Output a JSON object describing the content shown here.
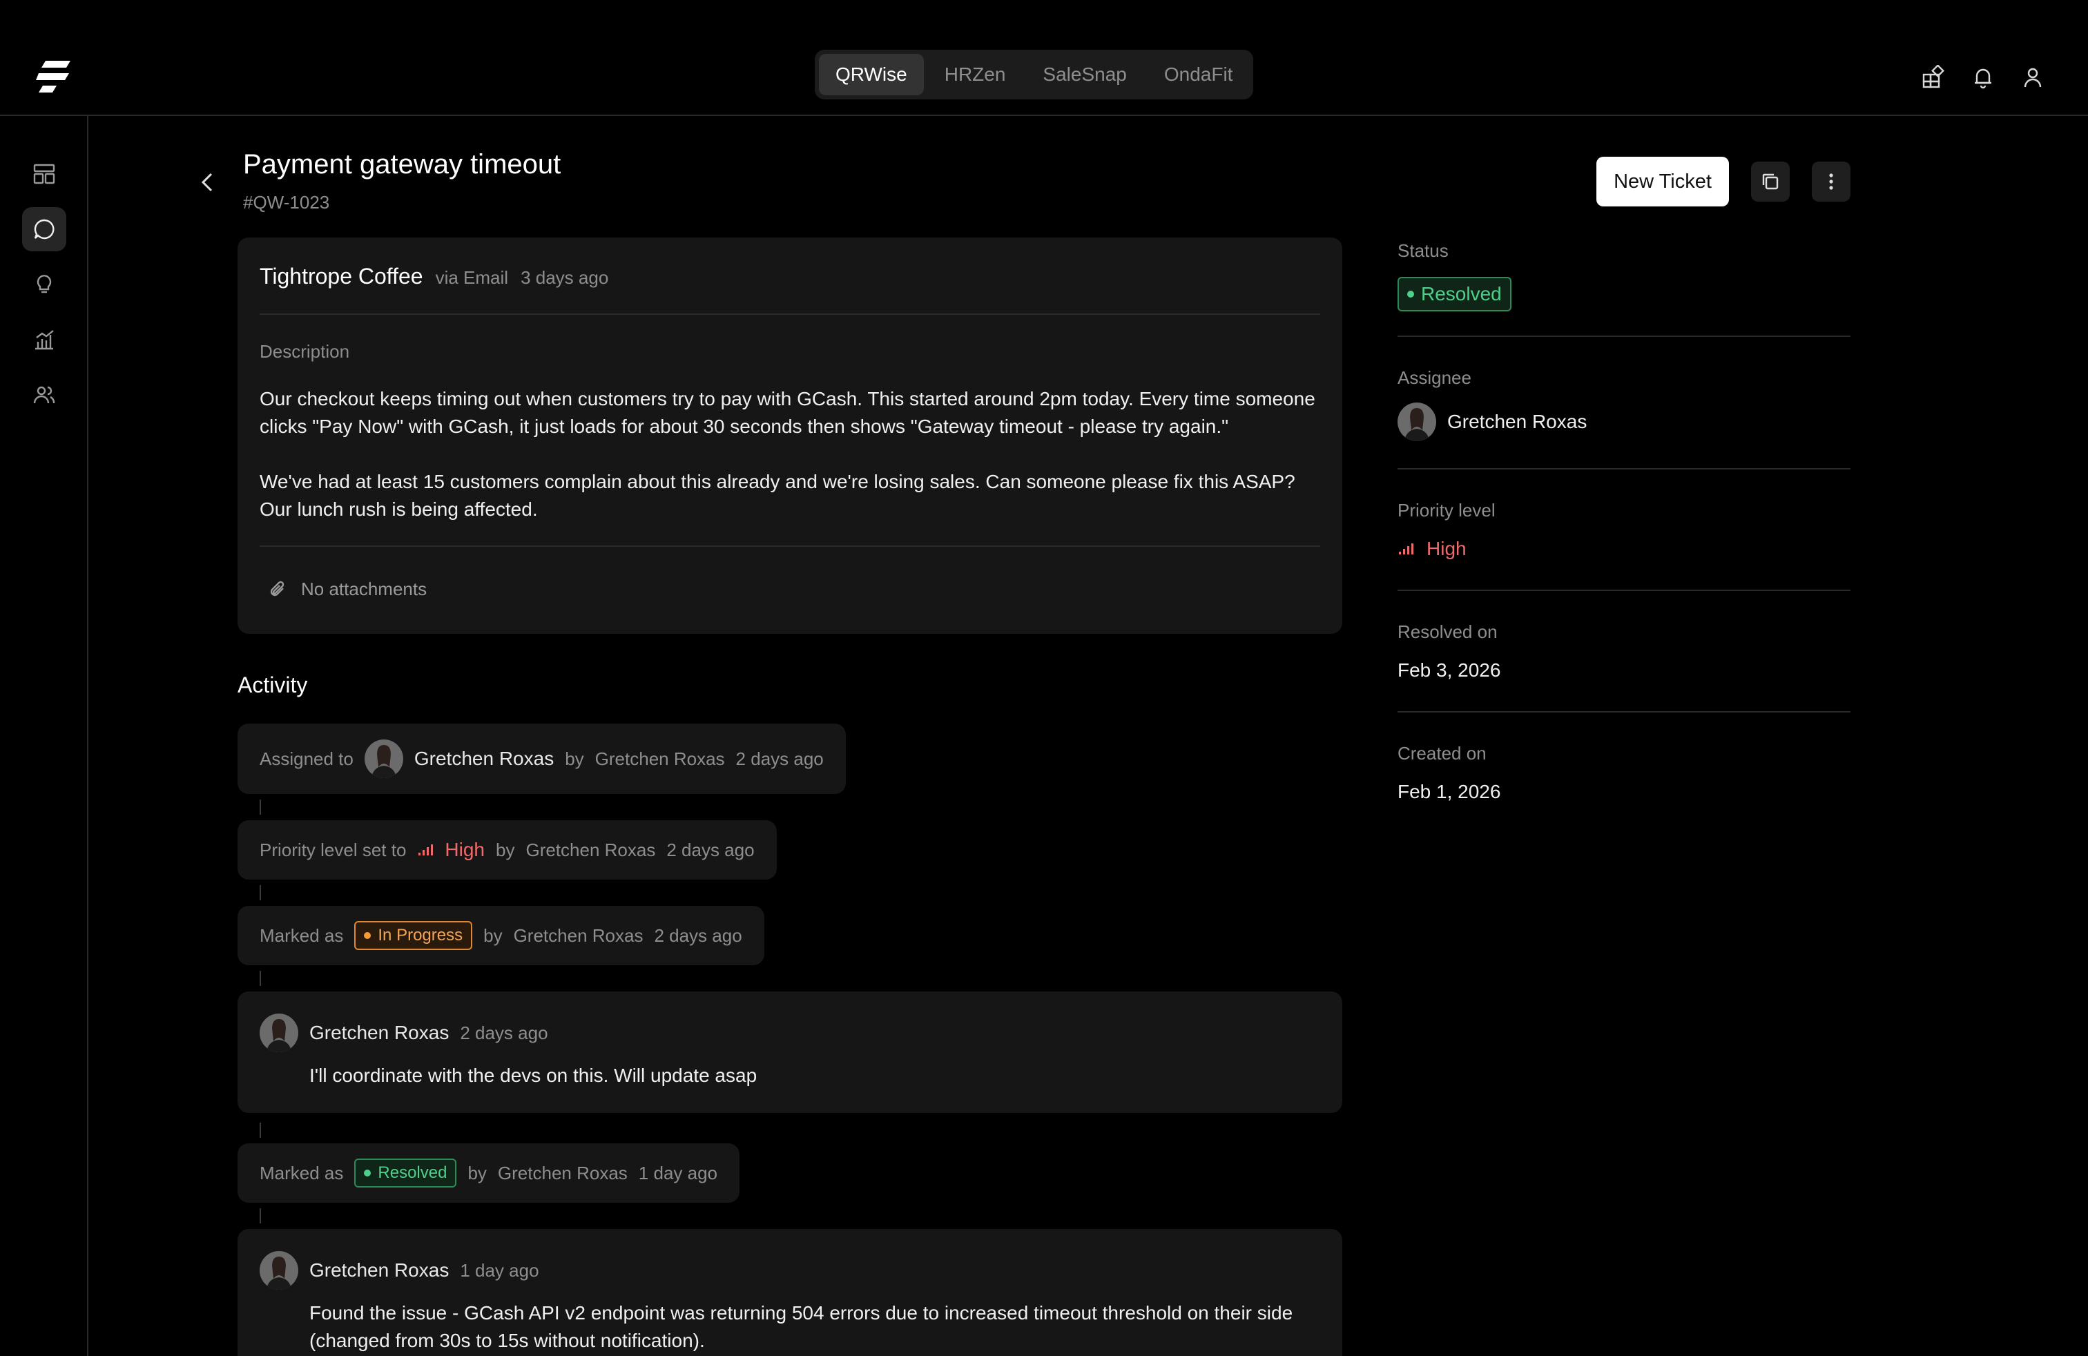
{
  "app_tabs": [
    {
      "label": "QRWise",
      "active": true
    },
    {
      "label": "HRZen",
      "active": false
    },
    {
      "label": "SaleSnap",
      "active": false
    },
    {
      "label": "OndaFit",
      "active": false
    }
  ],
  "top_icons": [
    "apps-icon",
    "bell-icon",
    "user-icon"
  ],
  "sidebar_icons": [
    "dashboard-icon",
    "chat-icon",
    "lightbulb-icon",
    "analytics-icon",
    "users-icon"
  ],
  "ticket": {
    "title": "Payment gateway timeout",
    "id": "#QW-1023",
    "new_ticket_label": "New Ticket",
    "customer": "Tightrope Coffee",
    "channel": "via Email",
    "age": "3 days ago",
    "description_label": "Description",
    "description_p1": "Our checkout keeps timing out when customers try to pay with GCash. This started around 2pm today. Every time someone clicks \"Pay Now\" with GCash, it just loads for about 30 seconds then shows \"Gateway timeout - please try again.\"",
    "description_p2": "We've had at least 15 customers complain about this already and we're losing sales. Can someone please fix this ASAP? Our lunch rush is being affected.",
    "attachments": "No attachments"
  },
  "activity": {
    "title": "Activity",
    "assigned": {
      "prefix": "Assigned to",
      "assignee": "Gretchen Roxas",
      "by": "by",
      "actor": "Gretchen Roxas",
      "when": "2 days ago"
    },
    "priority": {
      "prefix": "Priority level set to",
      "level": "High",
      "by": "by",
      "actor": "Gretchen Roxas",
      "when": "2 days ago"
    },
    "marked_progress": {
      "prefix": "Marked as",
      "status": "In Progress",
      "by": "by",
      "actor": "Gretchen Roxas",
      "when": "2 days ago"
    },
    "comment1": {
      "author": "Gretchen Roxas",
      "when": "2 days ago",
      "text": "I'll coordinate with the devs on this. Will update asap"
    },
    "marked_resolved": {
      "prefix": "Marked as",
      "status": "Resolved",
      "by": "by",
      "actor": "Gretchen Roxas",
      "when": "1 day ago"
    },
    "comment2": {
      "author": "Gretchen Roxas",
      "when": "1 day ago",
      "text": "Found the issue - GCash API v2 endpoint was returning 504 errors due to increased timeout threshold on their side (changed from 30s to 15s without notification)."
    }
  },
  "details": {
    "status_label": "Status",
    "status": "Resolved",
    "assignee_label": "Assignee",
    "assignee": "Gretchen Roxas",
    "priority_label": "Priority level",
    "priority": "High",
    "resolved_label": "Resolved on",
    "resolved": "Feb 3, 2026",
    "created_label": "Created on",
    "created": "Feb 1, 2026"
  },
  "colors": {
    "high": "#ef6b6b",
    "resolved": "#4fd08a",
    "in_progress": "#f39a3c"
  }
}
